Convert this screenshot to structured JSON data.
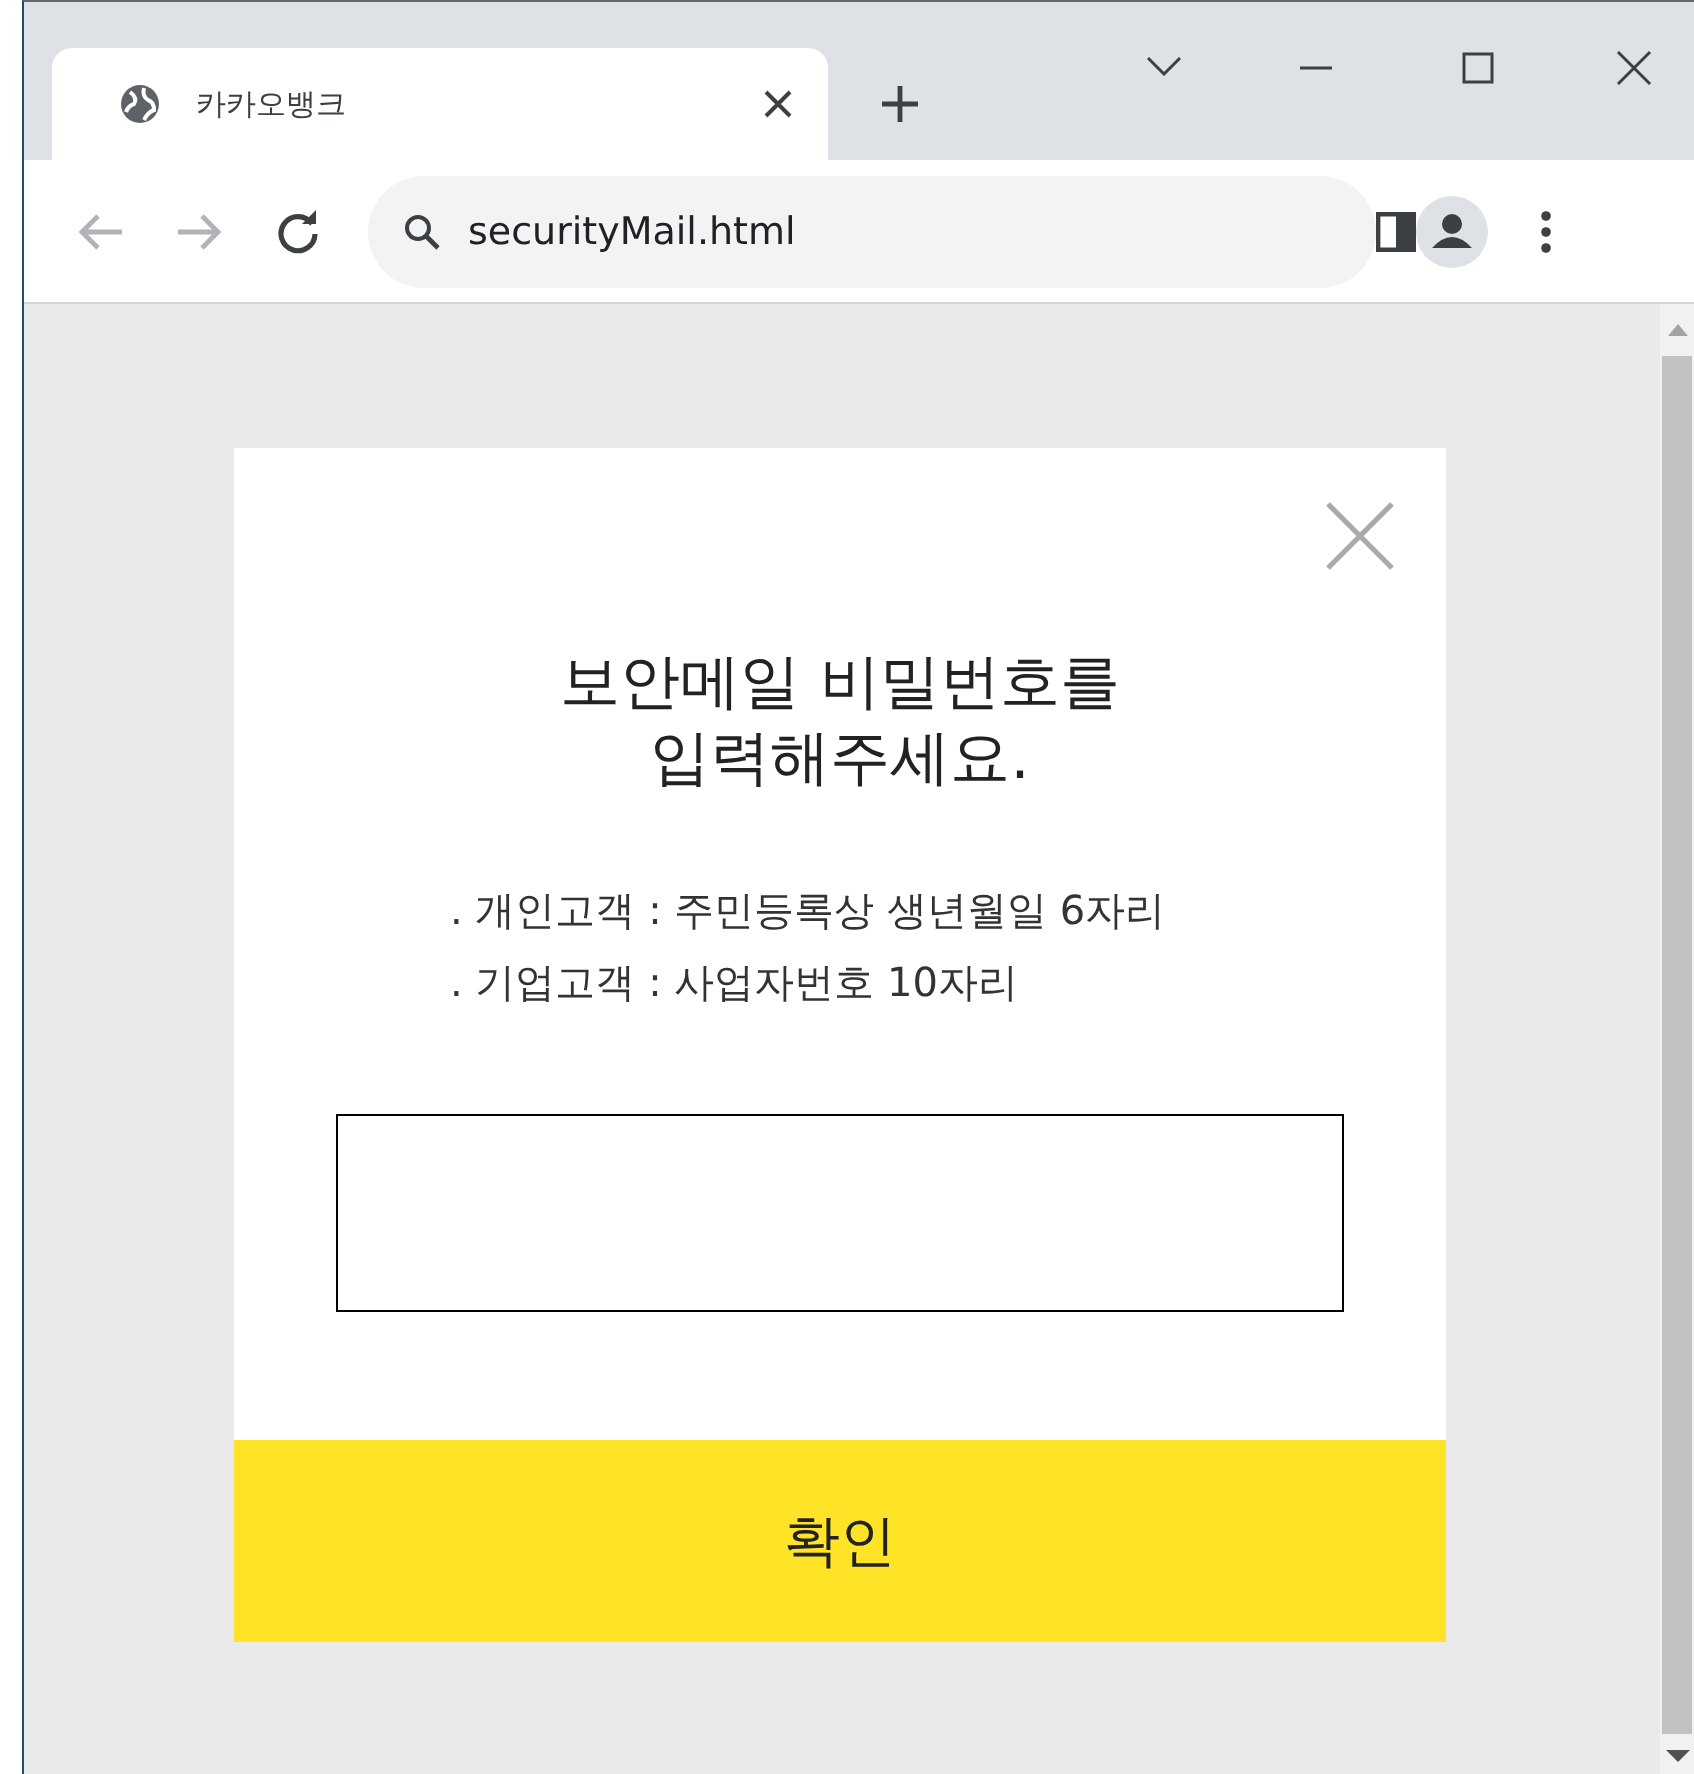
{
  "browser": {
    "tab": {
      "title": "카카오뱅크",
      "selected": true
    },
    "address": "securityMail.html"
  },
  "dialog": {
    "title_lines": [
      "보안메일 비밀번호를",
      "입력해주세요."
    ],
    "notes": [
      ". 개인고객 : 주민등록상 생년월일 6자리",
      ". 기업고객 : 사업자번호 10자리"
    ],
    "confirm_button": "확인"
  }
}
